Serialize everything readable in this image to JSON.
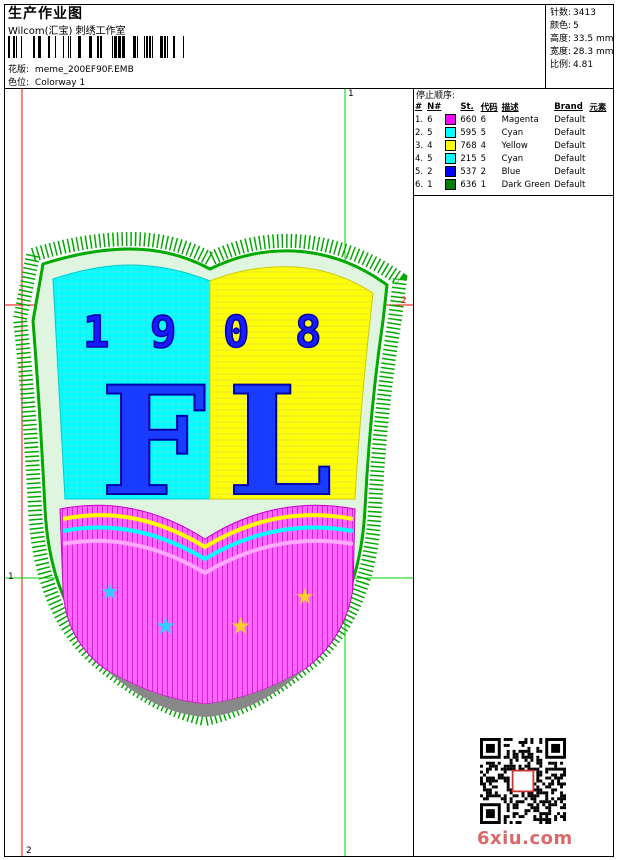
{
  "header": {
    "title": "生产作业图",
    "company": "Wilcom(汇宝) 刺绣工作室",
    "design_label": "花版:",
    "design_value": "meme_200EF90F.EMB",
    "colorway_label": "色位:",
    "colorway_value": "Colorway 1"
  },
  "stats": [
    {
      "label": "针数:",
      "value": "3413"
    },
    {
      "label": "颜色:",
      "value": "5"
    },
    {
      "label": "高度:",
      "value": "33.5 mm"
    },
    {
      "label": "宽度:",
      "value": "28.3 mm"
    },
    {
      "label": "比例:",
      "value": "4.81"
    }
  ],
  "stop_sequence": {
    "title": "停止顺序:",
    "headers": [
      "#",
      "N#",
      "St.",
      "代码",
      "描述",
      "Brand",
      "元素"
    ],
    "rows": [
      {
        "num": "1.",
        "n": "6",
        "color": "#ff00ff",
        "st": "660",
        "code": "6",
        "desc": "Magenta",
        "brand": "Default"
      },
      {
        "num": "2.",
        "n": "5",
        "color": "#00ffff",
        "st": "595",
        "code": "5",
        "desc": "Cyan",
        "brand": "Default"
      },
      {
        "num": "3.",
        "n": "4",
        "color": "#ffff00",
        "st": "768",
        "code": "4",
        "desc": "Yellow",
        "brand": "Default"
      },
      {
        "num": "4.",
        "n": "5",
        "color": "#00ffff",
        "st": "215",
        "code": "5",
        "desc": "Cyan",
        "brand": "Default"
      },
      {
        "num": "5.",
        "n": "2",
        "color": "#0000ff",
        "st": "537",
        "code": "2",
        "desc": "Blue",
        "brand": "Default"
      },
      {
        "num": "6.",
        "n": "1",
        "color": "#008000",
        "st": "636",
        "code": "1",
        "desc": "Dark Green",
        "brand": "Default"
      }
    ]
  },
  "design": {
    "year_digits": [
      "1",
      "9",
      "0",
      "8"
    ],
    "letters": [
      "F",
      "L"
    ]
  },
  "guides": {
    "top_label": "1",
    "right_label": "2",
    "left_label": "1",
    "bottom_label": "2"
  },
  "watermark": "6xiu.com",
  "colors": {
    "guide_red": "#ff0000",
    "guide_green": "#00cc00"
  }
}
